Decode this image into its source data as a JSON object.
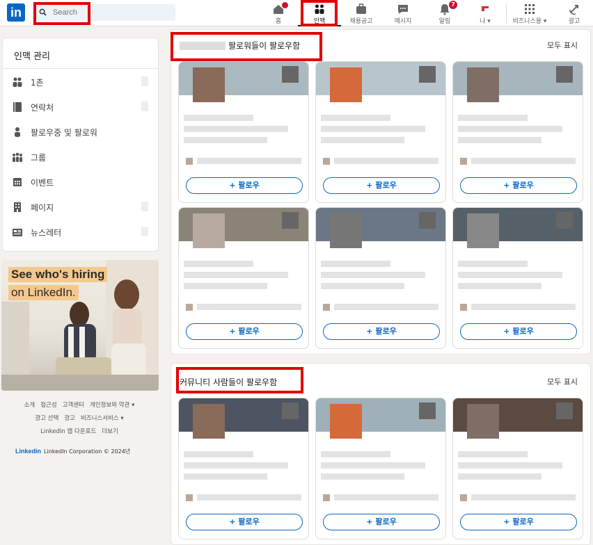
{
  "topnav": {
    "logo": "in",
    "search_placeholder": "Search",
    "items": [
      {
        "key": "home",
        "label": "홈",
        "badge": ""
      },
      {
        "key": "network",
        "label": "인맥",
        "badge": ""
      },
      {
        "key": "jobs",
        "label": "채용공고",
        "badge": ""
      },
      {
        "key": "messaging",
        "label": "메시지",
        "badge": ""
      },
      {
        "key": "notifications",
        "label": "알림",
        "badge": "7"
      },
      {
        "key": "me",
        "label": "나 ▾",
        "badge": ""
      },
      {
        "key": "business",
        "label": "비즈니스용 ▾",
        "badge": ""
      },
      {
        "key": "ads",
        "label": "광고",
        "badge": ""
      }
    ]
  },
  "sidebar": {
    "title": "인맥 관리",
    "items": [
      {
        "label": "1촌",
        "icon": "people-icon"
      },
      {
        "label": "연락처",
        "icon": "contact-book-icon"
      },
      {
        "label": "팔로우중 및 팔로워",
        "icon": "person-icon"
      },
      {
        "label": "그룹",
        "icon": "group-icon"
      },
      {
        "label": "이벤트",
        "icon": "calendar-icon"
      },
      {
        "label": "페이지",
        "icon": "building-icon"
      },
      {
        "label": "뉴스레터",
        "icon": "newsletter-icon"
      }
    ]
  },
  "ad": {
    "line1": "See who's hiring",
    "line2": "on LinkedIn."
  },
  "footer": {
    "row1": [
      "소개",
      "접근성",
      "고객센터",
      "개인정보와 약관 ▾"
    ],
    "row2": [
      "광고 선택",
      "광고",
      "비즈니스서비스 ▾"
    ],
    "row3": [
      "LinkedIn 앱 다운로드",
      "더보기"
    ],
    "brand": "Linkedin",
    "copyright": "LinkedIn Corporation © 2024년"
  },
  "section1": {
    "title": "팔로워들이 팔로우함",
    "more": "모두 표시"
  },
  "section2": {
    "title": "커뮤니티 사람들이 팔로우함",
    "more": "모두 표시"
  },
  "follow_label": "+ 팔로우",
  "colors": {
    "brand": "#0a66c2",
    "highlight": "#e10000",
    "badge": "#cb112d"
  }
}
